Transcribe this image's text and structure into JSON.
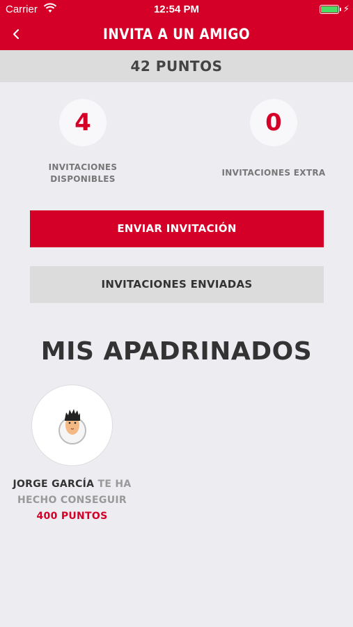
{
  "status_bar": {
    "carrier": "Carrier",
    "time": "12:54 PM",
    "battery_level": 1.0
  },
  "nav": {
    "title": "INVITA A UN AMIGO",
    "back_icon": "chevron-left-icon"
  },
  "points": {
    "label": "42 PUNTOS"
  },
  "stats": {
    "available": {
      "value": "4",
      "label_line1": "INVITACIONES",
      "label_line2": "DISPONIBLES"
    },
    "extra": {
      "value": "0",
      "label": "INVITACIONES EXTRA"
    }
  },
  "buttons": {
    "send": "ENVIAR INVITACIÓN",
    "sent": "INVITACIONES ENVIADAS"
  },
  "godchildren": {
    "title": "MIS APADRINADOS",
    "items": [
      {
        "name": "JORGE GARCÍA",
        "text_mid": "TE HA HECHO CONSEGUIR",
        "amount": "400",
        "unit": "PUNTOS"
      }
    ]
  },
  "colors": {
    "brand_red": "#d40028",
    "background": "#ececf1",
    "gray_bar": "#dcdcdc"
  }
}
